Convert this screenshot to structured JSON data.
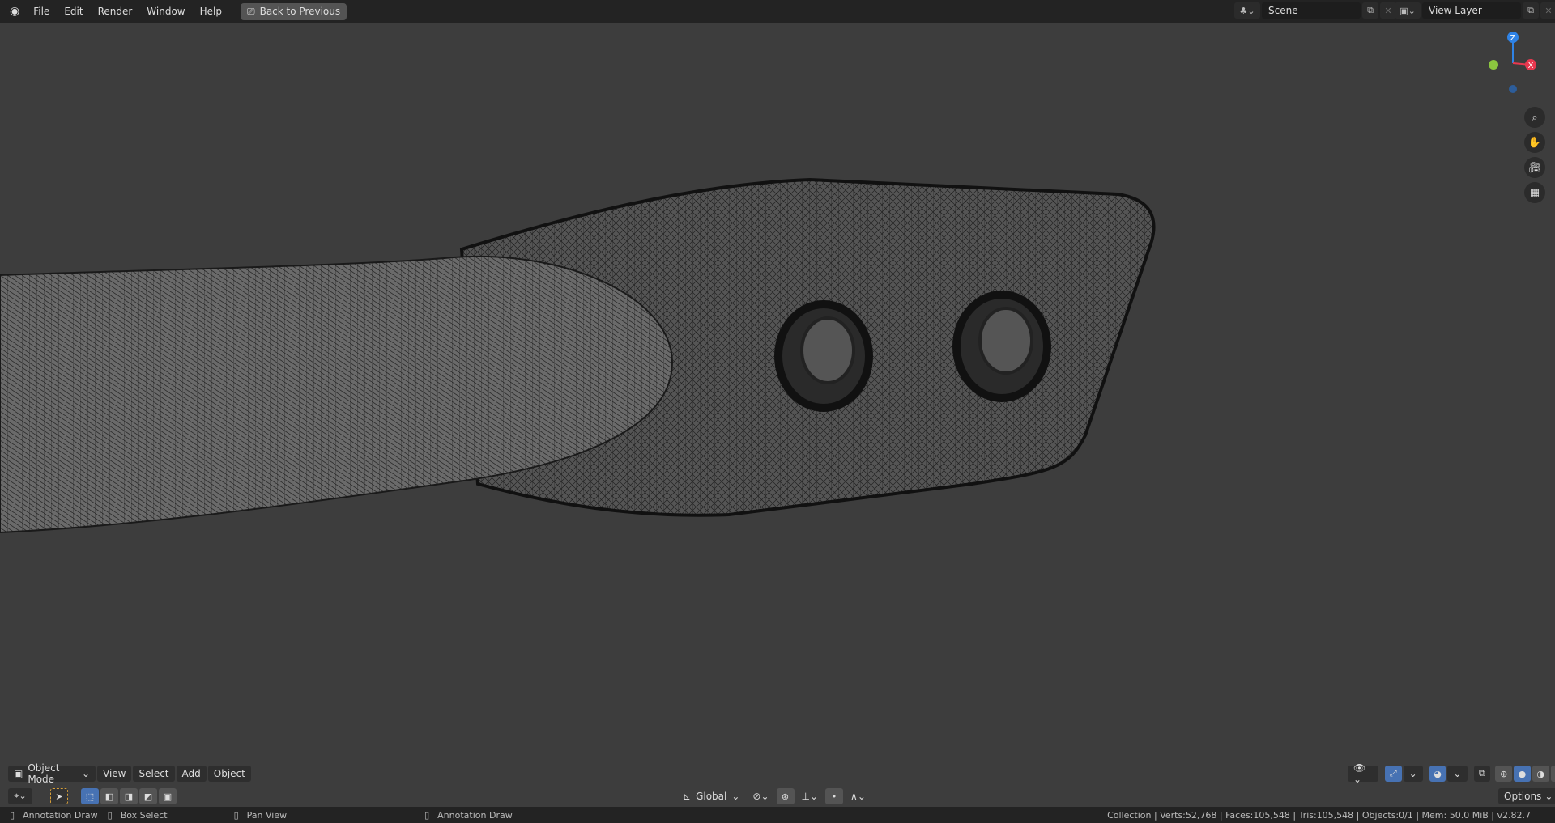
{
  "topbar": {
    "menus": [
      "File",
      "Edit",
      "Render",
      "Window",
      "Help"
    ],
    "back_button": "Back to Previous",
    "scene": "Scene",
    "view_layer": "View Layer"
  },
  "viewport_header": {
    "mode": "Object Mode",
    "menus": [
      "View",
      "Select",
      "Add",
      "Object"
    ],
    "transform_orientation": "Global",
    "options": "Options"
  },
  "gizmo": {
    "z": "Z",
    "x": "X",
    "colors": {
      "x": "#e8384f",
      "y": "#8bc53f",
      "z": "#2f83e6"
    }
  },
  "status": {
    "left_mouse": "Annotation Draw",
    "middle": "Box Select",
    "right": "Pan View",
    "extra": "Annotation Draw",
    "stats": "Collection | Verts:52,768 | Faces:105,548 | Tris:105,548 | Objects:0/1 | Mem: 50.0 MiB | v2.82.7"
  }
}
